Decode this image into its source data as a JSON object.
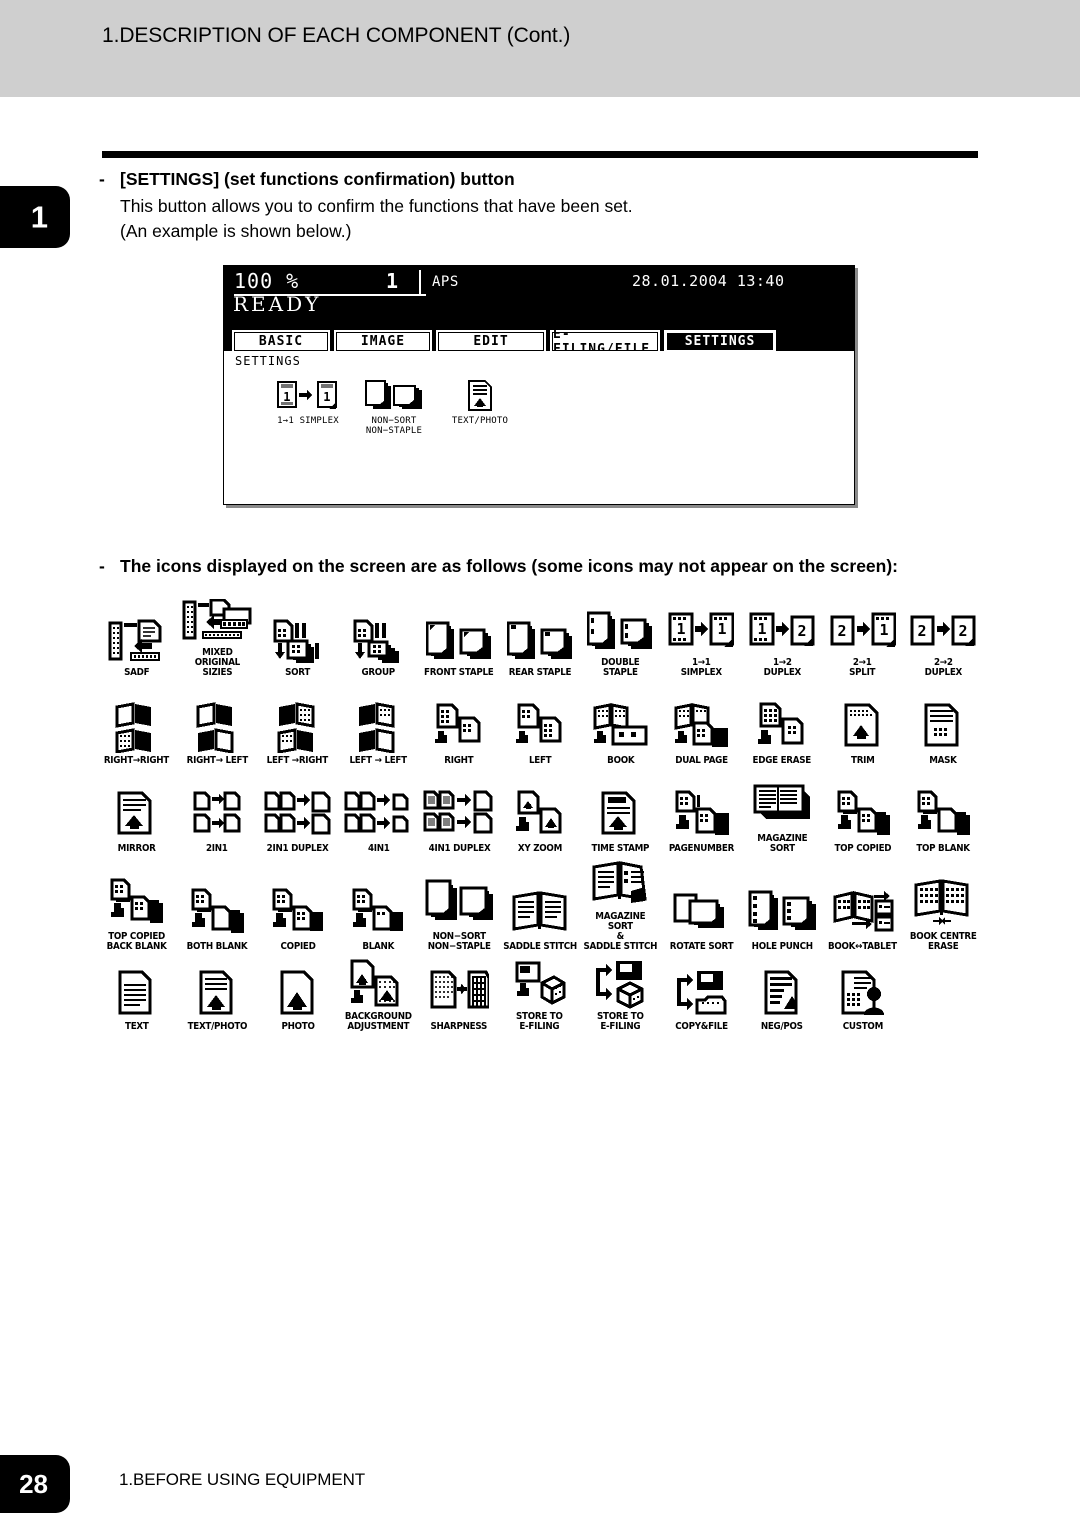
{
  "header": {
    "title": "1.DESCRIPTION OF EACH COMPONENT (Cont.)",
    "band_color": "#cfcfcf"
  },
  "chapter_tab": {
    "number": "1"
  },
  "section": {
    "bullet_dash": "-",
    "heading": "[SETTINGS] (set functions confirmation) button",
    "line1": "This button allows you to confirm the functions that have been set.",
    "line2": "(An example is shown below.)"
  },
  "lcd": {
    "ratio": "100 %",
    "copies": "1",
    "paper_mode": "APS",
    "datetime": "28.01.2004 13:40",
    "status": "READY",
    "tabs": [
      {
        "label": "BASIC",
        "active": false
      },
      {
        "label": "IMAGE",
        "active": false
      },
      {
        "label": "EDIT",
        "active": false
      },
      {
        "label": "E-FILING/FILE",
        "active": false
      },
      {
        "label": "SETTINGS",
        "active": true
      }
    ],
    "section_label": "SETTINGS",
    "settings": [
      {
        "label": "1→1\nSIMPLEX",
        "icon": "simplex-1to1-icon"
      },
      {
        "label": "NON−SORT\nNON−STAPLE",
        "icon": "non-sort-non-staple-icon"
      },
      {
        "label": "TEXT/PHOTO",
        "icon": "text-photo-icon"
      }
    ]
  },
  "icons_intro": {
    "dash": "-",
    "text": "The icons displayed on the screen are as follows (some icons may not appear on the screen):"
  },
  "icon_grid": {
    "rows": [
      [
        {
          "label": "SADF",
          "name": "sadf-icon"
        },
        {
          "label": "MIXED\nORIGINAL SIZIES",
          "name": "mixed-original-sizies-icon"
        },
        {
          "label": "SORT",
          "name": "sort-icon"
        },
        {
          "label": "GROUP",
          "name": "group-icon"
        },
        {
          "label": "FRONT STAPLE",
          "name": "front-staple-icon"
        },
        {
          "label": "REAR STAPLE",
          "name": "rear-staple-icon"
        },
        {
          "label": "DOUBLE STAPLE",
          "name": "double-staple-icon"
        },
        {
          "label": "1→1\nSIMPLEX",
          "name": "simplex-1to1-icon"
        },
        {
          "label": "1→2\nDUPLEX",
          "name": "duplex-1to2-icon"
        },
        {
          "label": "2→1\nSPLIT",
          "name": "split-2to1-icon"
        },
        {
          "label": "2→2\nDUPLEX",
          "name": "duplex-2to2-icon"
        }
      ],
      [
        {
          "label": "RIGHT→RIGHT",
          "name": "right-to-right-icon"
        },
        {
          "label": "RIGHT→ LEFT",
          "name": "right-to-left-icon"
        },
        {
          "label": "LEFT →RIGHT",
          "name": "left-to-right-icon"
        },
        {
          "label": "LEFT → LEFT",
          "name": "left-to-left-icon"
        },
        {
          "label": "RIGHT",
          "name": "right-icon"
        },
        {
          "label": "LEFT",
          "name": "left-icon"
        },
        {
          "label": "BOOK",
          "name": "book-icon"
        },
        {
          "label": "DUAL PAGE",
          "name": "dual-page-icon"
        },
        {
          "label": "EDGE ERASE",
          "name": "edge-erase-icon"
        },
        {
          "label": "TRIM",
          "name": "trim-icon"
        },
        {
          "label": "MASK",
          "name": "mask-icon"
        }
      ],
      [
        {
          "label": "MIRROR",
          "name": "mirror-icon"
        },
        {
          "label": "2IN1",
          "name": "2in1-icon"
        },
        {
          "label": "2IN1 DUPLEX",
          "name": "2in1-duplex-icon"
        },
        {
          "label": "4IN1",
          "name": "4in1-icon"
        },
        {
          "label": "4IN1 DUPLEX",
          "name": "4in1-duplex-icon"
        },
        {
          "label": "XY ZOOM",
          "name": "xy-zoom-icon"
        },
        {
          "label": "TIME STAMP",
          "name": "time-stamp-icon"
        },
        {
          "label": "PAGENUMBER",
          "name": "pagenumber-icon"
        },
        {
          "label": "MAGAZINE SORT",
          "name": "magazine-sort-icon"
        },
        {
          "label": "TOP COPIED",
          "name": "top-copied-icon"
        },
        {
          "label": "TOP BLANK",
          "name": "top-blank-icon"
        }
      ],
      [
        {
          "label": "TOP COPIED\nBACK BLANK",
          "name": "top-copied-back-blank-icon"
        },
        {
          "label": "BOTH BLANK",
          "name": "both-blank-icon"
        },
        {
          "label": "COPIED",
          "name": "copied-icon"
        },
        {
          "label": "BLANK",
          "name": "blank-icon"
        },
        {
          "label": "NON−SORT\nNON−STAPLE",
          "name": "non-sort-non-staple-icon"
        },
        {
          "label": "SADDLE STITCH",
          "name": "saddle-stitch-icon"
        },
        {
          "label": "MAGAZINE SORT\n&\nSADDLE STITCH",
          "name": "magazine-sort-saddle-stitch-icon"
        },
        {
          "label": "ROTATE SORT",
          "name": "rotate-sort-icon"
        },
        {
          "label": "HOLE PUNCH",
          "name": "hole-punch-icon"
        },
        {
          "label": "BOOK↔TABLET",
          "name": "book-tablet-icon"
        },
        {
          "label": "BOOK CENTRE\nERASE",
          "name": "book-centre-erase-icon"
        }
      ],
      [
        {
          "label": "TEXT",
          "name": "text-icon"
        },
        {
          "label": "TEXT/PHOTO",
          "name": "text-photo-icon"
        },
        {
          "label": "PHOTO",
          "name": "photo-icon"
        },
        {
          "label": "BACKGROUND\nADJUSTMENT",
          "name": "background-adjustment-icon"
        },
        {
          "label": "SHARPNESS",
          "name": "sharpness-icon"
        },
        {
          "label": "STORE TO\nE-FILING",
          "name": "store-to-e-filing-icon"
        },
        {
          "label": "STORE TO\nE-FILING",
          "name": "store-to-e-filing-alt-icon"
        },
        {
          "label": "COPY&FILE",
          "name": "copy-and-file-icon"
        },
        {
          "label": "NEG/POS",
          "name": "neg-pos-icon"
        },
        {
          "label": "CUSTOM",
          "name": "custom-icon"
        }
      ]
    ]
  },
  "footer": {
    "page_number": "28",
    "chapter_text": "1.BEFORE USING EQUIPMENT"
  }
}
